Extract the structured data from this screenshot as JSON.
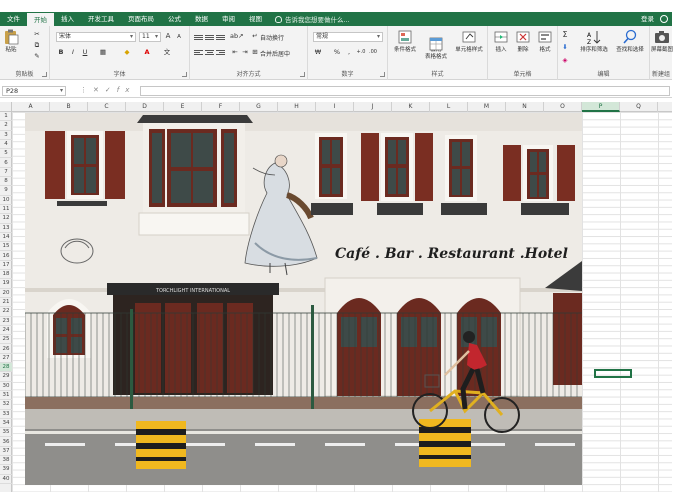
{
  "ribbon": {
    "tabs": [
      "文件",
      "开始",
      "插入",
      "开发工具",
      "页面布局",
      "公式",
      "数据",
      "审阅",
      "视图"
    ],
    "active_tab": "开始",
    "tell_me": "告诉我您想要做什么...",
    "login": "登录"
  },
  "groups": {
    "clipboard": {
      "label": "剪贴板",
      "paste": "粘贴"
    },
    "font": {
      "label": "字体",
      "font_name": "宋体",
      "font_size": "11",
      "bold": "B",
      "italic": "I",
      "underline": "U",
      "grow": "A",
      "shrink": "A"
    },
    "alignment": {
      "label": "对齐方式",
      "wrap": "自动换行",
      "merge": "合并后居中"
    },
    "number": {
      "label": "数字",
      "format": "常规",
      "percent": "%",
      "comma": ","
    },
    "styles": {
      "label": "样式",
      "conditional": "条件格式",
      "table": "套用\n表格格式",
      "cell_styles": "单元格样式"
    },
    "cells": {
      "label": "单元格",
      "insert": "插入",
      "delete": "删除",
      "format": "格式"
    },
    "editing": {
      "label": "编辑",
      "sort_filter": "排序和筛选",
      "find_select": "查找和选择"
    },
    "new_group": {
      "label": "新建组",
      "screenshot": "屏幕截图"
    }
  },
  "formula_bar": {
    "cell_ref": "P28",
    "value": ""
  },
  "columns": [
    "A",
    "B",
    "C",
    "D",
    "E",
    "F",
    "G",
    "H",
    "I",
    "J",
    "K",
    "L",
    "M",
    "N",
    "O",
    "P",
    "Q"
  ],
  "selected_column": "P",
  "rows": [
    "1",
    "2",
    "3",
    "4",
    "5",
    "6",
    "7",
    "8",
    "9",
    "10",
    "11",
    "12",
    "13",
    "14",
    "15",
    "16",
    "17",
    "18",
    "19",
    "20",
    "21",
    "22",
    "23",
    "24",
    "25",
    "26",
    "27",
    "28",
    "29",
    "30",
    "31",
    "32",
    "33",
    "34",
    "35",
    "36",
    "37",
    "38",
    "39",
    "40"
  ],
  "selected_row": "28",
  "picture": {
    "sign_text": "Café . Bar . Restaurant .Hotel",
    "awning_text": "TORCHLIGHT INTERNATIONAL"
  },
  "colors": {
    "accent": "#217346",
    "shutter": "#7a2e22",
    "wall": "#eeebe6",
    "barrier_yellow": "#f0b81f"
  }
}
